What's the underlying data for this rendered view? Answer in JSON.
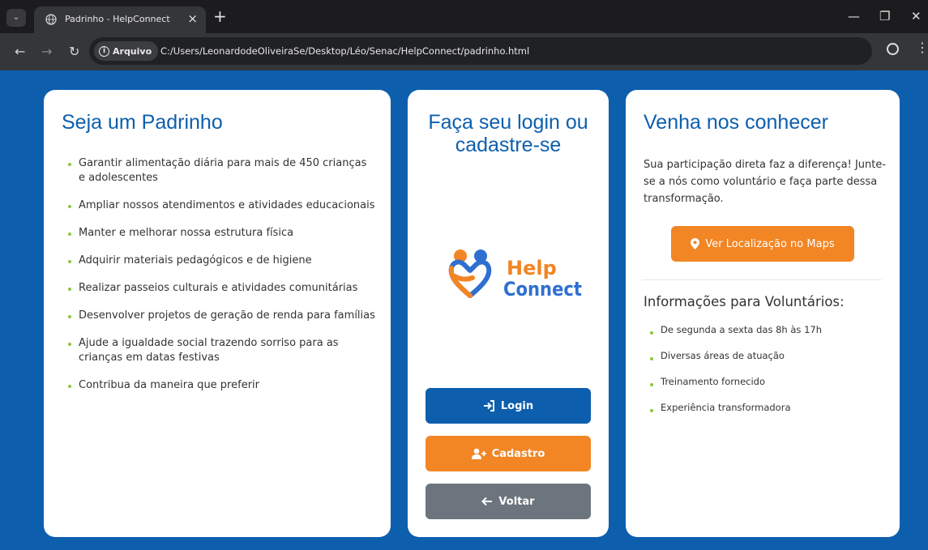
{
  "browser": {
    "tab_title": "Padrinho - HelpConnect",
    "site_info_label": "Arquivo",
    "url": "C:/Users/LeonardodeOliveiraSe/Desktop/Léo/Senac/HelpConnect/padrinho.html"
  },
  "left": {
    "title": "Seja um Padrinho",
    "items": [
      "Garantir alimentação diária para mais de 450 crianças e adolescentes",
      "Ampliar nossos atendimentos e atividades educacionais",
      "Manter e melhorar nossa estrutura física",
      "Adquirir materiais pedagógicos e de higiene",
      "Realizar passeios culturais e atividades comunitárias",
      "Desenvolver projetos de geração de renda para famílias",
      "Ajude a igualdade social trazendo sorriso para as crianças em datas festivas",
      "Contribua da maneira que preferir"
    ]
  },
  "middle": {
    "title": "Faça seu login ou cadastre-se",
    "logo_text_1": "Help",
    "logo_text_2": "Connect",
    "login_label": "Login",
    "cadastro_label": "Cadastro",
    "voltar_label": "Voltar"
  },
  "right": {
    "title": "Venha nos conhecer",
    "text": "Sua participação direta faz a diferença! Junte-se a nós como voluntário e faça parte dessa transformação.",
    "map_button": "Ver Localização no Maps",
    "volunteer_title": "Informações para Voluntários:",
    "volunteer_items": [
      "De segunda a sexta das 8h às 17h",
      "Diversas áreas de atuação",
      "Treinamento fornecido",
      "Experiência transformadora"
    ]
  },
  "colors": {
    "primary_blue": "#0d5fae",
    "orange": "#f28524",
    "gray": "#6c757d",
    "bullet_green": "#8cc63f"
  },
  "icons": {
    "login": "sign-in-icon",
    "cadastro": "user-plus-icon",
    "voltar": "arrow-left-icon",
    "map": "map-marker-icon"
  }
}
